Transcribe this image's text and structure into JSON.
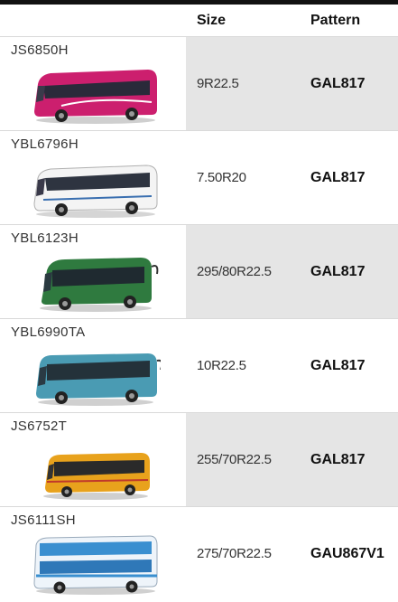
{
  "header": {
    "size_label": "Size",
    "pattern_label": "Pattern"
  },
  "rows": [
    {
      "model": "JS6850H",
      "size": "9R22.5",
      "pattern": "GAL817",
      "bus_color": "#cc1f6e",
      "bus_icon": "pink-coach-bus-image"
    },
    {
      "model": "YBL6796H",
      "size": "7.50R20",
      "pattern": "GAL817",
      "bus_color": "#eeeeee",
      "bus_icon": "white-coach-bus-image"
    },
    {
      "model": "YBL6123H",
      "size": "295/80R22.5",
      "pattern": "GAL817",
      "bus_color": "#2f7a3f",
      "bus_icon": "green-coach-bus-image"
    },
    {
      "model": "YBL6990TA",
      "size": "10R22.5",
      "pattern": "GAL817",
      "bus_color": "#4a9bb3",
      "bus_icon": "teal-coach-bus-image"
    },
    {
      "model": "JS6752T",
      "size": "255/70R22.5",
      "pattern": "GAL817",
      "bus_color": "#e8a21c",
      "bus_icon": "yellow-coach-bus-image"
    },
    {
      "model": "JS6111SH",
      "size": "275/70R22.5",
      "pattern": "GAU867V1",
      "bus_color": "#3a8fd0",
      "bus_icon": "blue-double-decker-bus-image"
    }
  ]
}
